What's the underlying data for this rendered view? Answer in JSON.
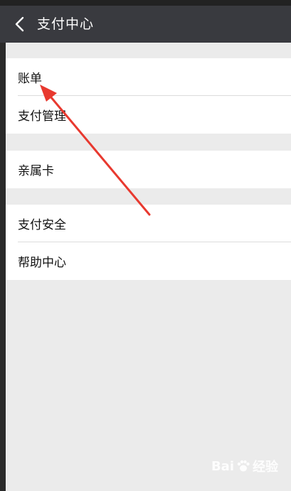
{
  "header": {
    "back_icon": "chevron-left-icon",
    "title": "支付中心"
  },
  "groups": [
    {
      "items": [
        {
          "label": "账单"
        },
        {
          "label": "支付管理"
        }
      ]
    },
    {
      "items": [
        {
          "label": "亲属卡"
        }
      ]
    },
    {
      "items": [
        {
          "label": "支付安全"
        },
        {
          "label": "帮助中心"
        }
      ]
    }
  ],
  "colors": {
    "titlebar": "#393a3f",
    "background": "#ebebeb",
    "annotation_arrow": "#e8392f"
  },
  "watermark": {
    "text_left": "Bai",
    "text_right": "经验",
    "icon": "paw-icon"
  }
}
